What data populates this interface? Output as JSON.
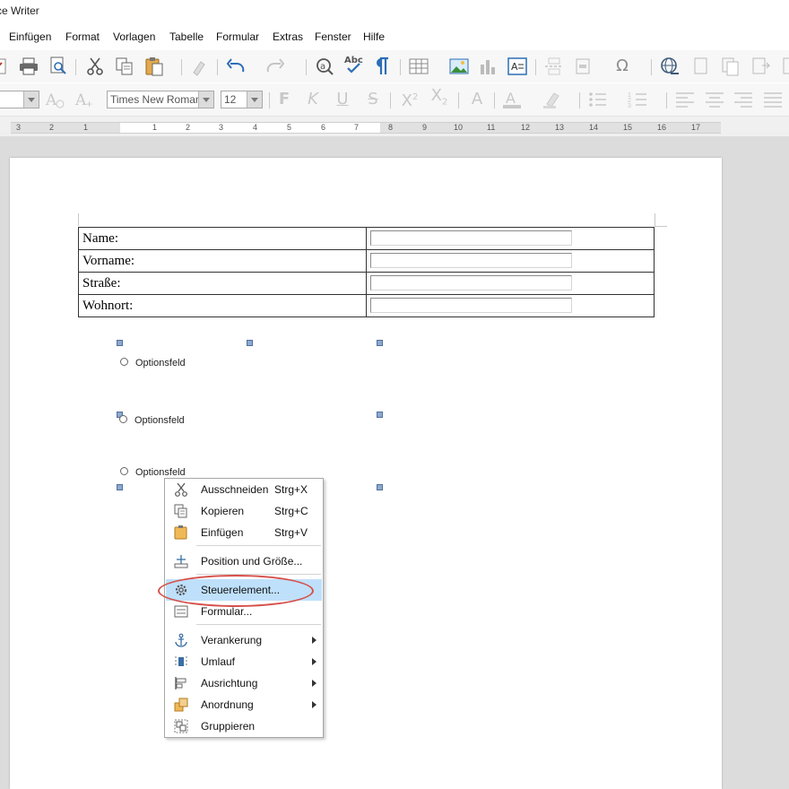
{
  "window": {
    "title": "ce Writer"
  },
  "menubar": {
    "items": [
      {
        "label": "Einfügen",
        "accel": "E"
      },
      {
        "label": "Format",
        "accel": "F"
      },
      {
        "label": "Vorlagen",
        "accel": "o"
      },
      {
        "label": "Tabelle",
        "accel": "T"
      },
      {
        "label": "Formular",
        "accel": "u"
      },
      {
        "label": "Extras",
        "accel": "E"
      },
      {
        "label": "Fenster",
        "accel": "s"
      },
      {
        "label": "Hilfe",
        "accel": "H"
      }
    ]
  },
  "toolbar2": {
    "font_name": "Times New Roman",
    "font_size": "12"
  },
  "ruler": {
    "ticks": [
      "3",
      "2",
      "1",
      "1",
      "2",
      "3",
      "4",
      "5",
      "6",
      "7",
      "8",
      "9",
      "10",
      "11",
      "12",
      "13",
      "14",
      "15",
      "16",
      "17"
    ]
  },
  "document": {
    "table_rows": [
      {
        "label": "Name:"
      },
      {
        "label": "Vorname:"
      },
      {
        "label": "Straße:"
      },
      {
        "label": "Wohnort:"
      }
    ],
    "options": [
      {
        "label": "Optionsfeld"
      },
      {
        "label": "Optionsfeld"
      },
      {
        "label": "Optionsfeld"
      }
    ]
  },
  "context_menu": {
    "items": [
      {
        "label": "Ausschneiden",
        "shortcut": "Strg+X",
        "icon": "scissors-icon"
      },
      {
        "label": "Kopieren",
        "shortcut": "Strg+C",
        "icon": "copy-icon"
      },
      {
        "label": "Einfügen",
        "shortcut": "Strg+V",
        "icon": "paste-icon"
      },
      {
        "label": "Position und Größe...",
        "icon": "position-size-icon"
      },
      {
        "label": "Steuerelement...",
        "icon": "gear-icon",
        "highlighted": true
      },
      {
        "label": "Formular...",
        "icon": "form-icon"
      },
      {
        "label": "Verankerung",
        "icon": "anchor-icon",
        "submenu": true
      },
      {
        "label": "Umlauf",
        "icon": "wrap-icon",
        "submenu": true
      },
      {
        "label": "Ausrichtung",
        "icon": "align-icon",
        "submenu": true
      },
      {
        "label": "Anordnung",
        "icon": "arrange-icon",
        "submenu": true
      },
      {
        "label": "Gruppieren",
        "icon": "group-icon"
      }
    ]
  },
  "colors": {
    "highlight": "#bfe0fb",
    "annotation_ring": "#d6504a",
    "selection_handle": "#8da9d0",
    "workspace": "#dcdcdc"
  }
}
